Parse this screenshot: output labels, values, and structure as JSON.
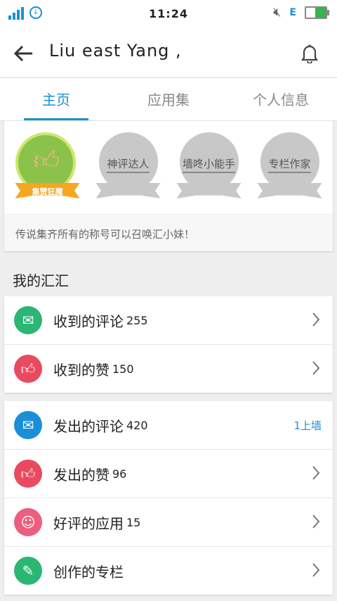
{
  "status": {
    "time": "11:24",
    "network": "E"
  },
  "header": {
    "title": "Liu east  Yang ,",
    "back_icon": "arrow-left-icon",
    "bell_icon": "bell-icon"
  },
  "tabs": [
    {
      "label": "主页",
      "active": true
    },
    {
      "label": "应用集"
    },
    {
      "label": "个人信息"
    }
  ],
  "badges": [
    {
      "name": "集赞狂魔",
      "active": true
    },
    {
      "name": "神评达人"
    },
    {
      "name": "墙咚小能手"
    },
    {
      "name": "专栏作家"
    }
  ],
  "badge_hint": "传说集齐所有的称号可以召唤汇小妹！",
  "section_title": "我的汇汇",
  "group1": [
    {
      "label": "收到的评论",
      "count": "255",
      "color": "#2bb673",
      "icon": "envelope-icon"
    },
    {
      "label": "收到的赞",
      "count": "150",
      "color": "#e84a5f",
      "icon": "thumbs-up-icon"
    }
  ],
  "group2": [
    {
      "label": "发出的评论",
      "count": "420",
      "color": "#1a8fd8",
      "icon": "send-envelope-icon",
      "tag": "1上墙"
    },
    {
      "label": "发出的赞",
      "count": "96",
      "color": "#e84a5f",
      "icon": "send-thumb-icon"
    },
    {
      "label": "好评的应用",
      "count": "15",
      "color": "#ea5f80",
      "icon": "smile-icon"
    },
    {
      "label": "创作的专栏",
      "count": "",
      "color": "#2bb673",
      "icon": "pencil-icon"
    }
  ],
  "colors": {
    "accent": "#1a8fd8"
  }
}
